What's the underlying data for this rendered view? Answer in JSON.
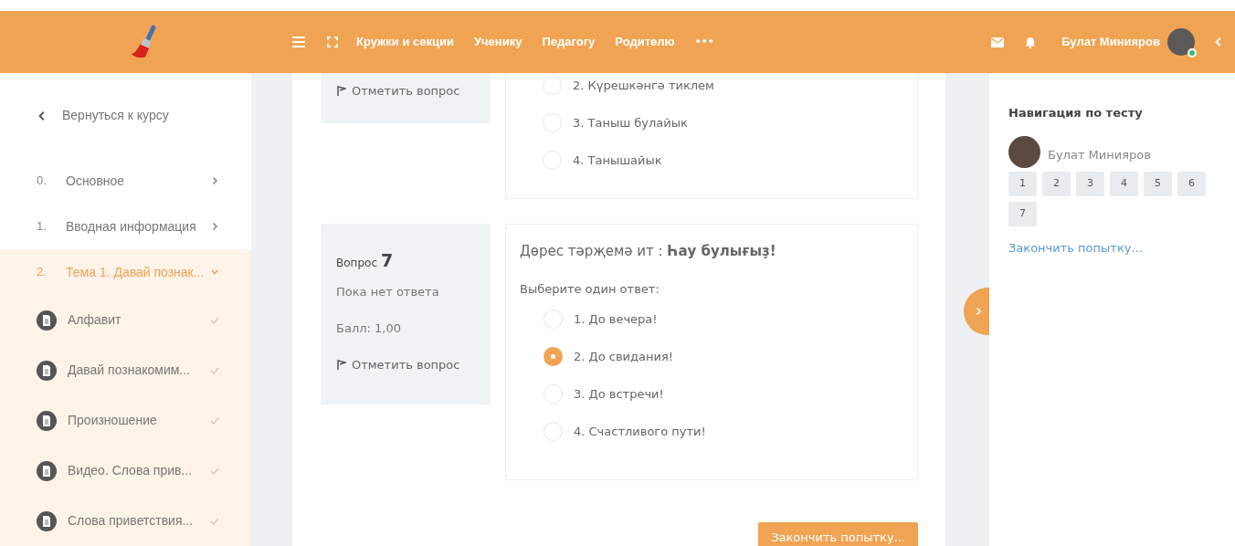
{
  "header": {
    "menu": [
      "Кружки и секции",
      "Ученику",
      "Педагогу",
      "Родителю"
    ],
    "more": "•••",
    "user_name": "Булат Минияров",
    "online": true
  },
  "sidebar": {
    "back": "Вернуться к курсу",
    "sections": [
      {
        "number": "0.",
        "title": "Основное",
        "expanded": false
      },
      {
        "number": "1.",
        "title": "Вводная информация",
        "expanded": false
      },
      {
        "number": "2.",
        "title": "Тема 1. Давай познак...",
        "expanded": true,
        "children": [
          {
            "title": "Алфавит",
            "done": true
          },
          {
            "title": "Давай познакомим...",
            "done": true
          },
          {
            "title": "Произношение",
            "done": true
          },
          {
            "title": "Видео. Слова прив...",
            "done": true
          },
          {
            "title": "Слова приветствия...",
            "done": true
          }
        ]
      }
    ]
  },
  "questions": [
    {
      "info": {
        "flag": "Отметить вопрос"
      },
      "options": [
        {
          "text": "2. Күрешкәнгә тиклем",
          "selected": false
        },
        {
          "text": "3. Таныш булайык",
          "selected": false
        },
        {
          "text": "4. Танышайык",
          "selected": false
        }
      ]
    },
    {
      "info": {
        "label": "Вопрос",
        "number": "7",
        "status": "Пока нет ответа",
        "score": "Балл: 1,00",
        "flag": "Отметить вопрос"
      },
      "prompt": "Дөрес тәрҗемә ит : **Һау булығыҙ!**",
      "instruction": "Выберите один ответ:",
      "options": [
        {
          "text": "1. До вечера!",
          "selected": false
        },
        {
          "text": "2. До свидания!",
          "selected": true
        },
        {
          "text": "3. До встречи!",
          "selected": false
        },
        {
          "text": "4. Счастливого пути!",
          "selected": false
        }
      ]
    }
  ],
  "finish_button": "Закончить попытку...",
  "quiz_nav": {
    "title": "Навигация по тесту",
    "user_name": "Булат Минияров",
    "pages": [
      "1",
      "2",
      "3",
      "4",
      "5",
      "6",
      "7"
    ],
    "finish_link": "Закончить попытку..."
  }
}
